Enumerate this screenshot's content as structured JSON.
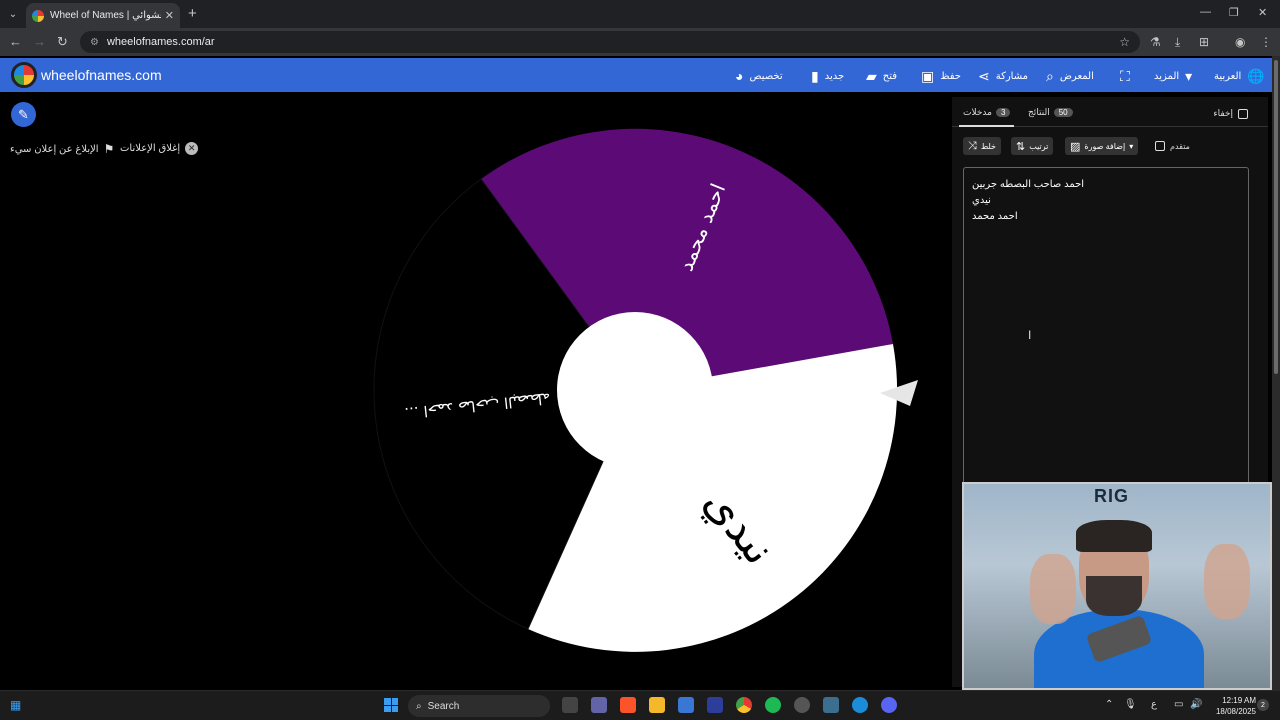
{
  "browser": {
    "tab_title": "Wheel of Names | سم العشوائي",
    "url": "wheelofnames.com/ar"
  },
  "appbar": {
    "brand": "wheelofnames.com",
    "menu": [
      {
        "label": "العربية",
        "icon": "globe-icon"
      },
      {
        "label": "المزيد",
        "icon": "chevron-down-icon"
      },
      {
        "label": "",
        "icon": "fullscreen-icon"
      },
      {
        "label": "المعرض",
        "icon": "search-icon"
      },
      {
        "label": "مشاركة",
        "icon": "share-icon"
      },
      {
        "label": "حفظ",
        "icon": "save-icon"
      },
      {
        "label": "فتح",
        "icon": "folder-icon"
      },
      {
        "label": "جديد",
        "icon": "new-file-icon"
      },
      {
        "label": "تخصيص",
        "icon": "palette-icon"
      }
    ]
  },
  "ads": {
    "report_label": "الإبلاغ عن إعلان سيء",
    "close_label": "إغلاق الإعلانات"
  },
  "wheel": {
    "segments": [
      {
        "label": "احمد محمد",
        "color": "#5c0a75"
      },
      {
        "label": "نيدي",
        "color": "#ffffff"
      },
      {
        "label": "احمد صاحب البصطه ...",
        "color": "#000000"
      }
    ]
  },
  "panel": {
    "hide_label": "إخفاء",
    "results_label": "النتائج",
    "results_count": "50",
    "entries_label": "مدخلات",
    "entries_count": "3",
    "shuffle_label": "خلط",
    "sort_label": "ترتيب",
    "add_image_label": "إضافة صورة",
    "advanced_label": "متقدم",
    "entries": [
      "احمد صاحب البصطه جربين",
      "نيدي",
      "احمد محمد"
    ]
  },
  "taskbar": {
    "search_label": "Search",
    "time": "12:19 AM",
    "date": "18/08/2025",
    "lang": "ع",
    "notifications": "2"
  }
}
